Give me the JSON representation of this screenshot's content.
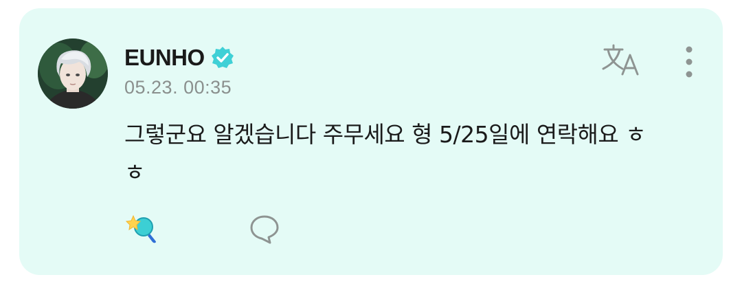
{
  "post": {
    "author": "EUNHO",
    "timestamp": "05.23. 00:35",
    "body": "그렇군요 알겠습니다 주무세요 형 5/25일에 연락해요 ㅎㅎ"
  },
  "icons": {
    "avatar": "avatar",
    "verified": "verified-badge-icon",
    "translate": "translate-icon",
    "more": "more-vertical-icon",
    "reaction": "star-reaction-icon",
    "comment": "comment-bubble-icon"
  },
  "colors": {
    "card_background": "#e4fbf6",
    "verified_badge": "#3fd0d6",
    "text_primary": "#1a1a1a",
    "text_secondary": "#8a8f8d",
    "icon_gray": "#8e9492"
  }
}
